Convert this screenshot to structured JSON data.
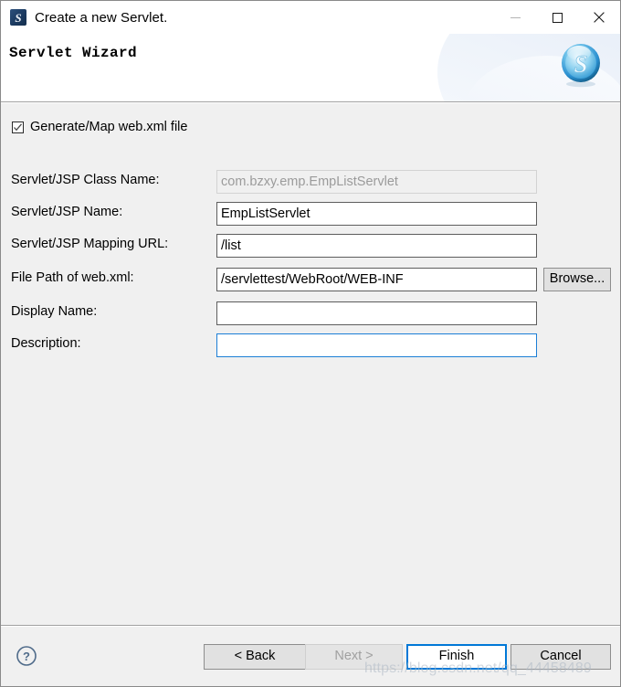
{
  "window": {
    "title": "Create a new Servlet.",
    "app_icon": "servlet-app-icon",
    "controls": {
      "minimize": "minimize-icon",
      "maximize": "maximize-icon",
      "close": "close-icon"
    }
  },
  "header": {
    "title": "Servlet Wizard",
    "logo_letter": "S"
  },
  "form": {
    "generate_checkbox": {
      "label": "Generate/Map web.xml file",
      "checked": true
    },
    "fields": [
      {
        "label": "Servlet/JSP Class Name:",
        "value": "com.bzxy.emp.EmpListServlet",
        "placeholder": "",
        "disabled": true,
        "focused": false
      },
      {
        "label": "Servlet/JSP Name:",
        "value": "EmpListServlet",
        "placeholder": "",
        "disabled": false,
        "focused": false
      },
      {
        "label": "Servlet/JSP Mapping URL:",
        "value": "/list",
        "placeholder": "",
        "disabled": false,
        "focused": false
      },
      {
        "label": "File Path of web.xml:",
        "value": "/servlettest/WebRoot/WEB-INF",
        "placeholder": "",
        "disabled": false,
        "focused": false
      },
      {
        "label": "Display Name:",
        "value": "",
        "placeholder": "",
        "disabled": false,
        "focused": false
      },
      {
        "label": "Description:",
        "value": "",
        "placeholder": "",
        "disabled": false,
        "focused": true
      }
    ],
    "browse_label": "Browse..."
  },
  "footer": {
    "help_icon": "help-icon",
    "buttons": {
      "back": "< Back",
      "next": "Next >",
      "finish": "Finish",
      "cancel": "Cancel"
    }
  },
  "watermark": "https://blog.csdn.net/qq_44458489",
  "colors": {
    "focus_blue": "#0078d7",
    "body_gray": "#f0f0f0",
    "button_gray": "#e1e1e1"
  }
}
